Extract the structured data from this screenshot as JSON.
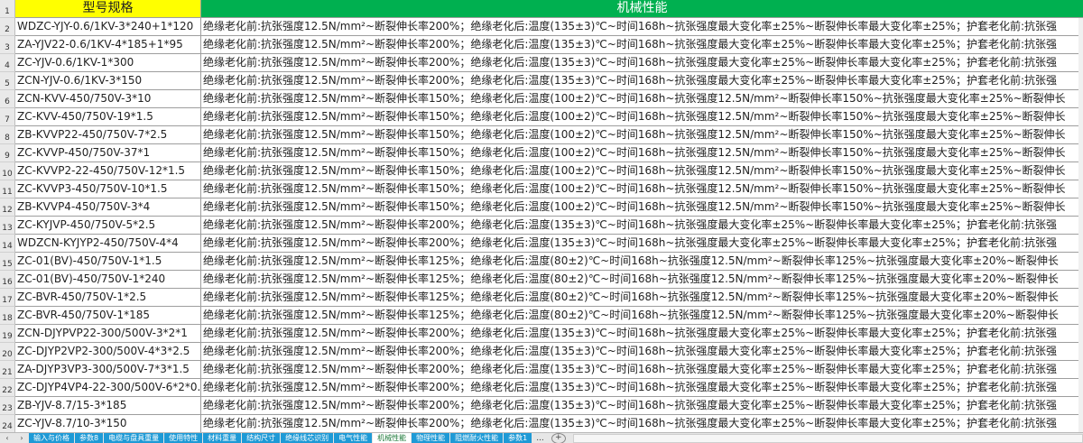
{
  "header": {
    "row_num": "1",
    "col_a": "型号规格",
    "col_b": "机械性能"
  },
  "rows": [
    {
      "n": "2",
      "a": "WDZC-YJY-0.6/1KV-3*240+1*120",
      "b": "绝缘老化前:抗张强度12.5N/mm²~断裂伸长率200%；绝缘老化后:温度(135±3)℃~时间168h~抗张强度最大变化率±25%~断裂伸长率最大变化率±25%；护套老化前:抗张强"
    },
    {
      "n": "3",
      "a": "ZA-YJV22-0.6/1KV-4*185+1*95",
      "b": "绝缘老化前:抗张强度12.5N/mm²~断裂伸长率200%；绝缘老化后:温度(135±3)℃~时间168h~抗张强度最大变化率±25%~断裂伸长率最大变化率±25%；护套老化前:抗张强"
    },
    {
      "n": "4",
      "a": "ZC-YJV-0.6/1KV-1*300",
      "b": "绝缘老化前:抗张强度12.5N/mm²~断裂伸长率200%；绝缘老化后:温度(135±3)℃~时间168h~抗张强度最大变化率±25%~断裂伸长率最大变化率±25%；护套老化前:抗张强"
    },
    {
      "n": "5",
      "a": "ZCN-YJV-0.6/1KV-3*150",
      "b": "绝缘老化前:抗张强度12.5N/mm²~断裂伸长率200%；绝缘老化后:温度(135±3)℃~时间168h~抗张强度最大变化率±25%~断裂伸长率最大变化率±25%；护套老化前:抗张强"
    },
    {
      "n": "6",
      "a": "ZCN-KVV-450/750V-3*10",
      "b": "绝缘老化前:抗张强度12.5N/mm²~断裂伸长率150%；绝缘老化后:温度(100±2)℃~时间168h~抗张强度12.5N/mm²~断裂伸长率150%~抗张强度最大变化率±25%~断裂伸长"
    },
    {
      "n": "7",
      "a": "ZC-KVV-450/750V-19*1.5",
      "b": "绝缘老化前:抗张强度12.5N/mm²~断裂伸长率150%；绝缘老化后:温度(100±2)℃~时间168h~抗张强度12.5N/mm²~断裂伸长率150%~抗张强度最大变化率±25%~断裂伸长"
    },
    {
      "n": "8",
      "a": "ZB-KVVP22-450/750V-7*2.5",
      "b": "绝缘老化前:抗张强度12.5N/mm²~断裂伸长率150%；绝缘老化后:温度(100±2)℃~时间168h~抗张强度12.5N/mm²~断裂伸长率150%~抗张强度最大变化率±25%~断裂伸长"
    },
    {
      "n": "9",
      "a": "ZC-KVVP-450/750V-37*1",
      "b": "绝缘老化前:抗张强度12.5N/mm²~断裂伸长率150%；绝缘老化后:温度(100±2)℃~时间168h~抗张强度12.5N/mm²~断裂伸长率150%~抗张强度最大变化率±25%~断裂伸长"
    },
    {
      "n": "10",
      "a": "ZC-KVVP2-22-450/750V-12*1.5",
      "b": "绝缘老化前:抗张强度12.5N/mm²~断裂伸长率150%；绝缘老化后:温度(100±2)℃~时间168h~抗张强度12.5N/mm²~断裂伸长率150%~抗张强度最大变化率±25%~断裂伸长"
    },
    {
      "n": "11",
      "a": "ZC-KVVP3-450/750V-10*1.5",
      "b": "绝缘老化前:抗张强度12.5N/mm²~断裂伸长率150%；绝缘老化后:温度(100±2)℃~时间168h~抗张强度12.5N/mm²~断裂伸长率150%~抗张强度最大变化率±25%~断裂伸长"
    },
    {
      "n": "12",
      "a": "ZB-KVVP4-450/750V-3*4",
      "b": "绝缘老化前:抗张强度12.5N/mm²~断裂伸长率150%；绝缘老化后:温度(100±2)℃~时间168h~抗张强度12.5N/mm²~断裂伸长率150%~抗张强度最大变化率±25%~断裂伸长"
    },
    {
      "n": "13",
      "a": "ZC-KYJVP-450/750V-5*2.5",
      "b": "绝缘老化前:抗张强度12.5N/mm²~断裂伸长率200%；绝缘老化后:温度(135±3)℃~时间168h~抗张强度最大变化率±25%~断裂伸长率最大变化率±25%；护套老化前:抗张强"
    },
    {
      "n": "14",
      "a": "WDZCN-KYJYP2-450/750V-4*4",
      "b": "绝缘老化前:抗张强度12.5N/mm²~断裂伸长率200%；绝缘老化后:温度(135±3)℃~时间168h~抗张强度最大变化率±25%~断裂伸长率最大变化率±25%；护套老化前:抗张强"
    },
    {
      "n": "15",
      "a": "ZC-01(BV)-450/750V-1*1.5",
      "b": "绝缘老化前:抗张强度12.5N/mm²~断裂伸长率125%；绝缘老化后:温度(80±2)℃~时间168h~抗张强度12.5N/mm²~断裂伸长率125%~抗张强度最大变化率±20%~断裂伸长"
    },
    {
      "n": "16",
      "a": "ZC-01(BV)-450/750V-1*240",
      "b": "绝缘老化前:抗张强度12.5N/mm²~断裂伸长率125%；绝缘老化后:温度(80±2)℃~时间168h~抗张强度12.5N/mm²~断裂伸长率125%~抗张强度最大变化率±20%~断裂伸长"
    },
    {
      "n": "17",
      "a": "ZC-BVR-450/750V-1*2.5",
      "b": "绝缘老化前:抗张强度12.5N/mm²~断裂伸长率125%；绝缘老化后:温度(80±2)℃~时间168h~抗张强度12.5N/mm²~断裂伸长率125%~抗张强度最大变化率±20%~断裂伸长"
    },
    {
      "n": "18",
      "a": "ZC-BVR-450/750V-1*185",
      "b": "绝缘老化前:抗张强度12.5N/mm²~断裂伸长率125%；绝缘老化后:温度(80±2)℃~时间168h~抗张强度12.5N/mm²~断裂伸长率125%~抗张强度最大变化率±20%~断裂伸长"
    },
    {
      "n": "19",
      "a": "ZCN-DJYPVP22-300/500V-3*2*1",
      "b": "绝缘老化前:抗张强度12.5N/mm²~断裂伸长率200%；绝缘老化后:温度(135±3)℃~时间168h~抗张强度最大变化率±25%~断裂伸长率最大变化率±25%；护套老化前:抗张强"
    },
    {
      "n": "20",
      "a": "ZC-DJYP2VP2-300/500V-4*3*2.5",
      "b": "绝缘老化前:抗张强度12.5N/mm²~断裂伸长率200%；绝缘老化后:温度(135±3)℃~时间168h~抗张强度最大变化率±25%~断裂伸长率最大变化率±25%；护套老化前:抗张强"
    },
    {
      "n": "21",
      "a": "ZA-DJYP3VP3-300/500V-7*3*1.5",
      "b": "绝缘老化前:抗张强度12.5N/mm²~断裂伸长率200%；绝缘老化后:温度(135±3)℃~时间168h~抗张强度最大变化率±25%~断裂伸长率最大变化率±25%；护套老化前:抗张强"
    },
    {
      "n": "22",
      "a": "ZC-DJYP4VP4-22-300/500V-6*2*0.",
      "b": "绝缘老化前:抗张强度12.5N/mm²~断裂伸长率200%；绝缘老化后:温度(135±3)℃~时间168h~抗张强度最大变化率±25%~断裂伸长率最大变化率±25%；护套老化前:抗张强"
    },
    {
      "n": "23",
      "a": "ZB-YJV-8.7/15-3*185",
      "b": "绝缘老化前:抗张强度12.5N/mm²~断裂伸长率200%；绝缘老化后:温度(135±3)℃~时间168h~抗张强度最大变化率±25%~断裂伸长率最大变化率±25%；护套老化前:抗张强"
    },
    {
      "n": "24",
      "a": "ZC-YJV-8.7/10-3*150",
      "b": "绝缘老化前:抗张强度12.5N/mm²~断裂伸长率200%；绝缘老化后:温度(135±3)℃~时间168h~抗张强度最大变化率±25%~断裂伸长率最大变化率±25%；护套老化前:抗张强"
    }
  ],
  "sheet_nav": {
    "prev": "‹",
    "next": "›"
  },
  "tabs": [
    {
      "label": "输入与价格",
      "active": false
    },
    {
      "label": "参数8",
      "active": false
    },
    {
      "label": "电缆与盘具重量",
      "active": false
    },
    {
      "label": "使用特性",
      "active": false
    },
    {
      "label": "材料重量",
      "active": false
    },
    {
      "label": "结构尺寸",
      "active": false
    },
    {
      "label": "绝缘线芯识别",
      "active": false
    },
    {
      "label": "电气性能",
      "active": false
    },
    {
      "label": "机械性能",
      "active": true
    },
    {
      "label": "物理性能",
      "active": false
    },
    {
      "label": "阻燃耐火性能",
      "active": false
    },
    {
      "label": "参数1",
      "active": false
    }
  ],
  "tab_more": "...",
  "add_tab": "+",
  "colors": {
    "header_a_bg": "#ffff00",
    "header_b_bg": "#00b050",
    "tab_bg": "#1e9ad6",
    "active_tab_text": "#1e7a3a"
  }
}
